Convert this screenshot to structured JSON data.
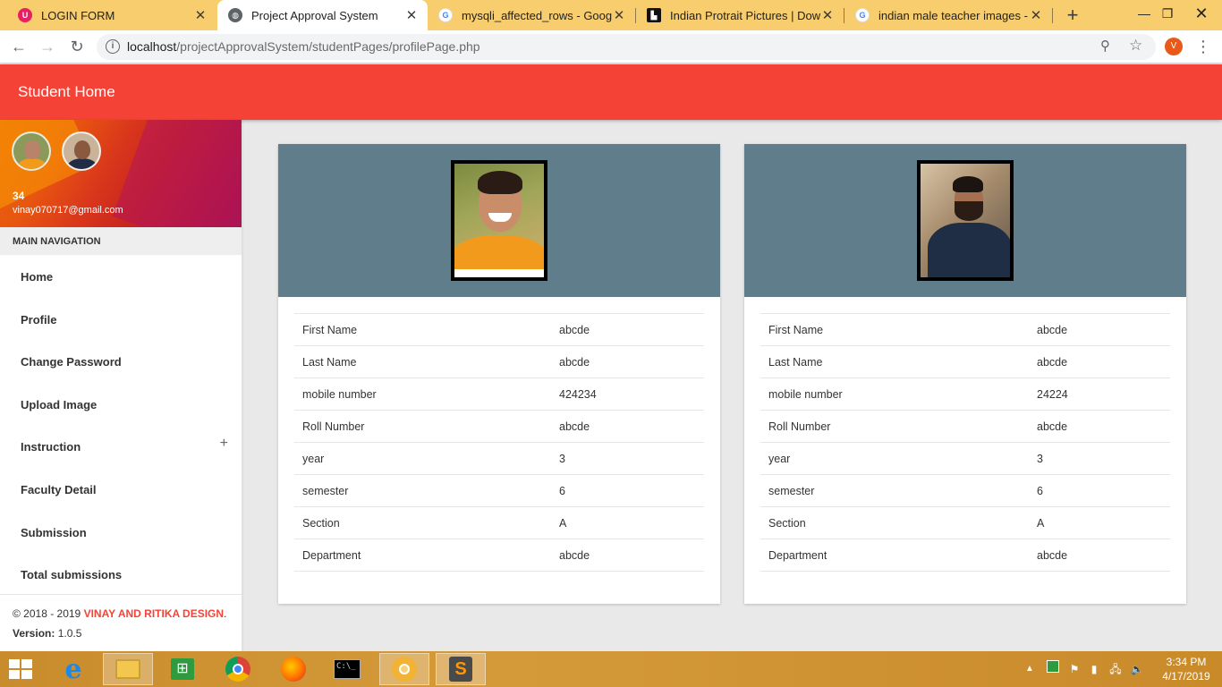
{
  "browser": {
    "tabs": [
      {
        "title": "LOGIN FORM",
        "favicon": "login-form-favicon",
        "color": "#e91e63",
        "active": false
      },
      {
        "title": "Project Approval System",
        "favicon": "globe-icon",
        "color": "#5f6368",
        "active": true
      },
      {
        "title": "mysqli_affected_rows - Google S",
        "favicon": "google-icon",
        "color": "#4285f4",
        "active": false
      },
      {
        "title": "Indian Protrait Pictures | Downlo",
        "favicon": "unsplash-icon",
        "color": "#111111",
        "active": false
      },
      {
        "title": "indian male teacher images - Go",
        "favicon": "google-icon",
        "color": "#4285f4",
        "active": false
      }
    ],
    "url_host": "localhost",
    "url_path": "/projectApprovalSystem/studentPages/profilePage.php",
    "profile_initial": "V"
  },
  "app": {
    "title": "Student Home",
    "accent_color": "#f44336"
  },
  "sidebar": {
    "user_name": "34",
    "user_email": "vinay070717@gmail.com",
    "nav_header": "MAIN NAVIGATION",
    "items": [
      {
        "label": "Home"
      },
      {
        "label": "Profile"
      },
      {
        "label": "Change Password"
      },
      {
        "label": "Upload Image"
      },
      {
        "label": "Instruction",
        "expand": "+"
      },
      {
        "label": "Faculty Detail"
      },
      {
        "label": "Submission"
      },
      {
        "label": "Total submissions"
      }
    ],
    "footer": {
      "copyright": "© 2018 - 2019 ",
      "brand": "VINAY AND RITIKA DESIGN",
      "dot": ".",
      "version_label": "Version:",
      "version_value": " 1.0.5"
    }
  },
  "cards": [
    {
      "rows": [
        {
          "label": "First Name",
          "value": "abcde"
        },
        {
          "label": "Last Name",
          "value": "abcde"
        },
        {
          "label": "mobile number",
          "value": "424234"
        },
        {
          "label": "Roll Number",
          "value": "abcde"
        },
        {
          "label": "year",
          "value": "3"
        },
        {
          "label": "semester",
          "value": "6"
        },
        {
          "label": "Section",
          "value": "A"
        },
        {
          "label": "Department",
          "value": "abcde"
        }
      ]
    },
    {
      "rows": [
        {
          "label": "First Name",
          "value": "abcde"
        },
        {
          "label": "Last Name",
          "value": "abcde"
        },
        {
          "label": "mobile number",
          "value": "24224"
        },
        {
          "label": "Roll Number",
          "value": "abcde"
        },
        {
          "label": "year",
          "value": "3"
        },
        {
          "label": "semester",
          "value": "6"
        },
        {
          "label": "Section",
          "value": "A"
        },
        {
          "label": "Department",
          "value": "abcde"
        }
      ]
    }
  ],
  "taskbar": {
    "apps": [
      "start-icon",
      "internet-explorer-icon",
      "file-explorer-icon",
      "store-icon",
      "chrome-icon",
      "firefox-icon",
      "command-prompt-icon",
      "chrome-canary-icon",
      "sublime-text-icon"
    ],
    "time": "3:34 PM",
    "date": "4/17/2019"
  }
}
